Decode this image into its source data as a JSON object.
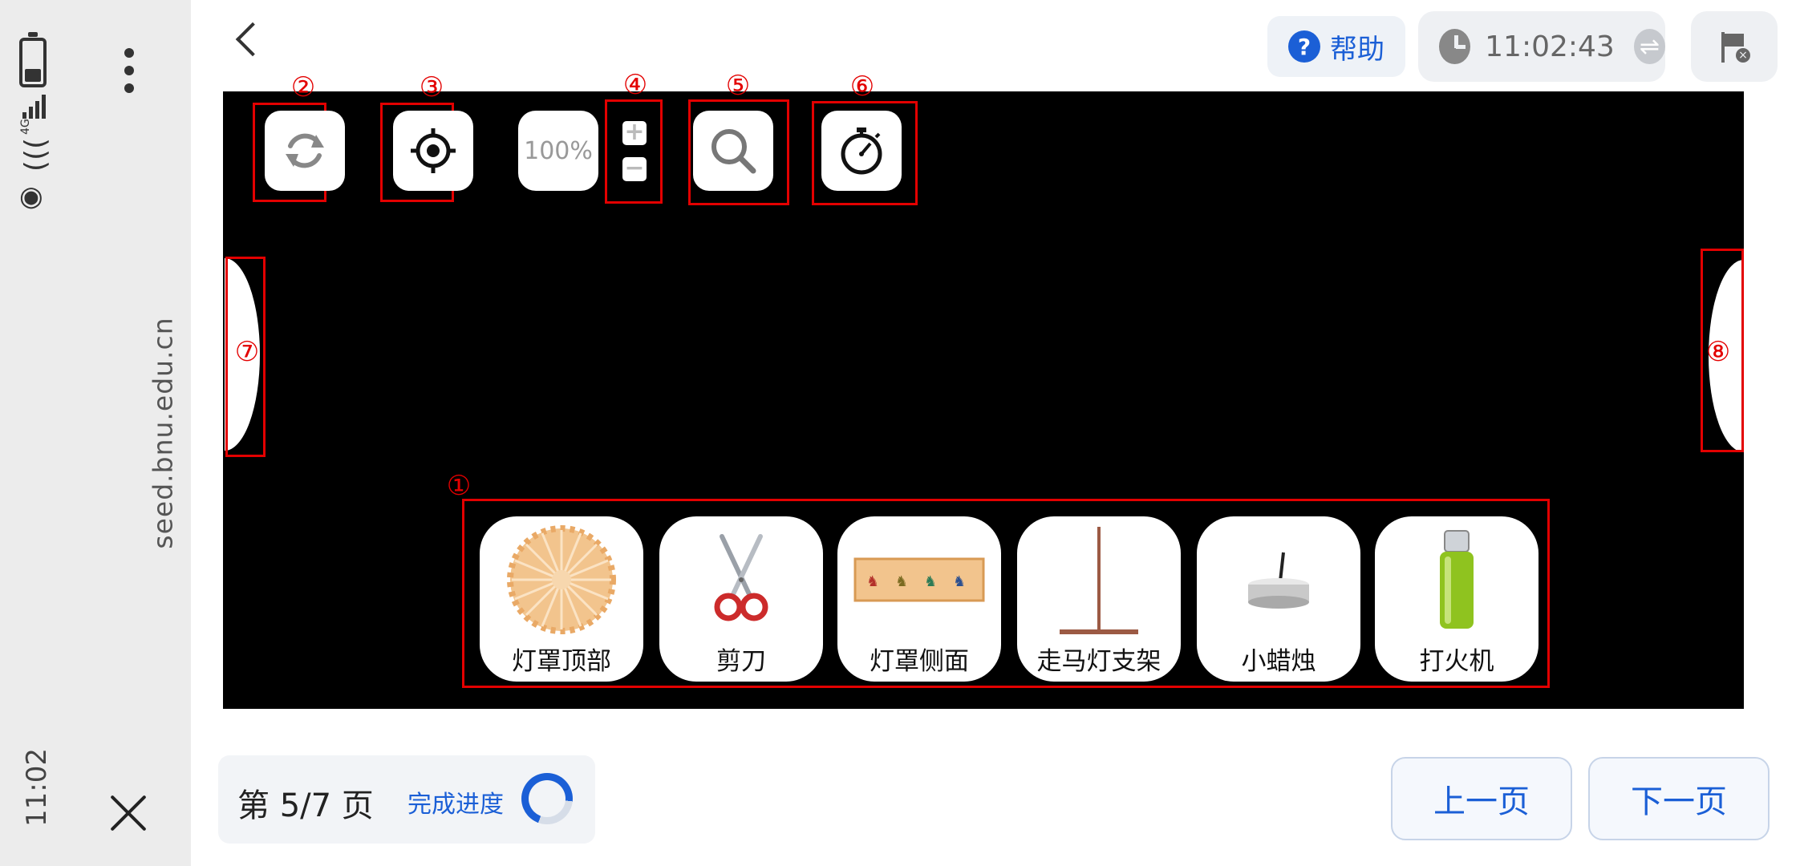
{
  "system": {
    "network": "4G",
    "url": "seed.bnu.edu.cn",
    "time": "11:02"
  },
  "header": {
    "help_label": "帮助",
    "help_icon": "?",
    "timer": "11:02:43"
  },
  "toolbar": {
    "zoom_level": "100%",
    "zoom_in": "+",
    "zoom_out": "−"
  },
  "markers": [
    "①",
    "②",
    "③",
    "④",
    "⑤",
    "⑥",
    "⑦",
    "⑧"
  ],
  "items": [
    {
      "label": "灯罩顶部",
      "icon": "lantern-top-icon"
    },
    {
      "label": "剪刀",
      "icon": "scissors-icon"
    },
    {
      "label": "灯罩侧面",
      "icon": "lantern-side-icon"
    },
    {
      "label": "走马灯支架",
      "icon": "lantern-stand-icon"
    },
    {
      "label": "小蜡烛",
      "icon": "candle-icon"
    },
    {
      "label": "打火机",
      "icon": "lighter-icon"
    }
  ],
  "footer": {
    "page_indicator": "第 5/7 页",
    "progress_label": "完成进度",
    "progress": 0.71,
    "prev_label": "上一页",
    "next_label": "下一页"
  },
  "colors": {
    "accent": "#1b5fd6",
    "stage": "#000000",
    "annotation": "#e30000"
  }
}
